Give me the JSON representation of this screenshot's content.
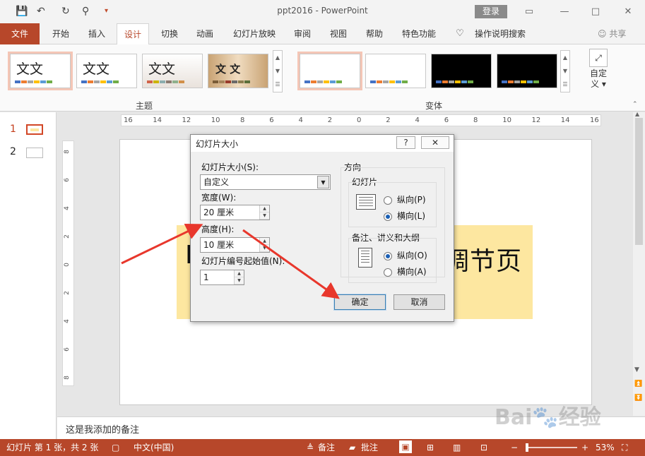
{
  "window": {
    "title": "ppt2016 - PowerPoint",
    "login": "登录",
    "qat_save": "💾",
    "qat_undo": "↶",
    "qat_redo": "↻",
    "qat_present": "⚲",
    "qat_more": "▾",
    "min": "🗕",
    "restore": "□",
    "close": "✕",
    "ribbon_toggle": "▭"
  },
  "tabs": {
    "file": "文件",
    "home": "开始",
    "insert": "插入",
    "design": "设计",
    "transitions": "切换",
    "animations": "动画",
    "slideshow": "幻灯片放映",
    "review": "审阅",
    "view": "视图",
    "help": "帮助",
    "special": "特色功能",
    "tellme": "操作说明搜索",
    "share": "共享"
  },
  "ribbon": {
    "themes_label": "主题",
    "variants_label": "变体",
    "theme_texts": [
      "文文",
      "文文",
      "文文",
      "文 文"
    ],
    "customize": "自定义"
  },
  "thumbnails": [
    "1",
    "2"
  ],
  "ruler": {
    "h": [
      "16",
      "14",
      "12",
      "10",
      "8",
      "6",
      "4",
      "2",
      "0",
      "2",
      "4",
      "6",
      "8",
      "10",
      "12",
      "14",
      "16"
    ],
    "v": [
      "8",
      "6",
      "4",
      "2",
      "0",
      "2",
      "4",
      "6",
      "8"
    ]
  },
  "slide": {
    "title_left": "L",
    "title_right": "调节页"
  },
  "notes": "这是我添加的备注",
  "status": {
    "slide_info": "幻灯片 第 1 张，共 2 张",
    "language": "中文(中国)",
    "notes_btn": "备注",
    "comments_btn": "批注",
    "zoom": "53%"
  },
  "dialog": {
    "title": "幻灯片大小",
    "help": "?",
    "close": "✕",
    "size_label": "幻灯片大小(S):",
    "size_value": "自定义",
    "width_label": "宽度(W):",
    "width_value": "20 厘米",
    "height_label": "高度(H):",
    "height_value": "10 厘米",
    "start_label": "幻灯片编号起始值(N):",
    "start_value": "1",
    "orientation": "方向",
    "slides_group": "幻灯片",
    "portrait_p": "纵向(P)",
    "landscape_l": "横向(L)",
    "notes_group": "备注、讲义和大纲",
    "portrait_o": "纵向(O)",
    "landscape_a": "横向(A)",
    "ok": "确定",
    "cancel": "取消"
  },
  "colors": {
    "accent": "#b7472a",
    "banner": "#fde7a0",
    "arrow": "#e8372c"
  }
}
